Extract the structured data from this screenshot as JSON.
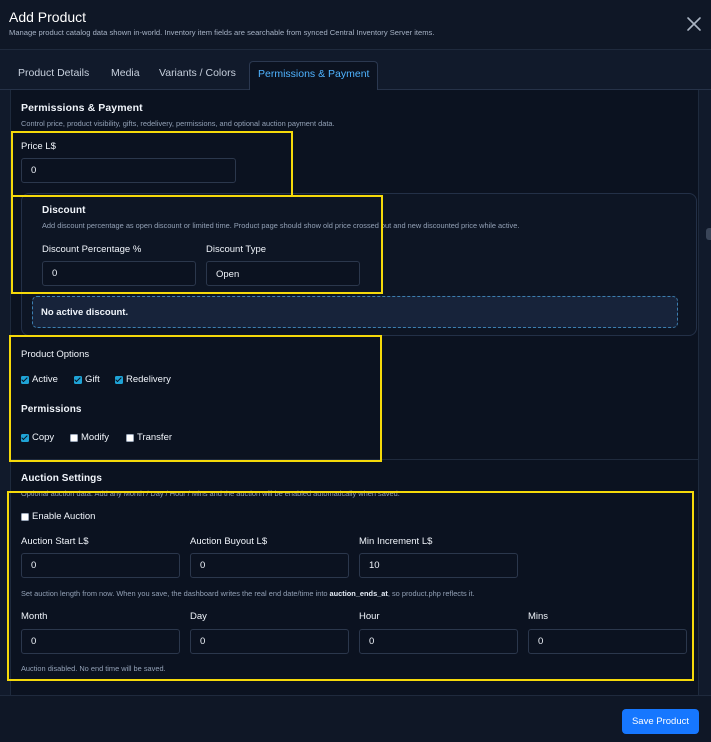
{
  "header": {
    "title": "Add Product",
    "subtitle": "Manage product catalog data shown in-world. Inventory item fields are searchable from synced Central Inventory Server items."
  },
  "tabs": [
    {
      "label": "Product Details",
      "active": false
    },
    {
      "label": "Media",
      "active": false
    },
    {
      "label": "Variants / Colors",
      "active": false
    },
    {
      "label": "Permissions & Payment",
      "active": true
    }
  ],
  "permissions_payment": {
    "title": "Permissions & Payment",
    "help": "Control price, product visibility, gifts, redelivery, permissions, and optional auction payment data.",
    "price_label": "Price L$",
    "price_value": "0"
  },
  "discount": {
    "title": "Discount",
    "help": "Add discount percentage as open discount or limited time. Product page should show old price crossed out and new discounted price while active.",
    "percentage_label": "Discount Percentage %",
    "percentage_value": "0",
    "type_label": "Discount Type",
    "type_value": "Open",
    "notice": "No active discount."
  },
  "product_options": {
    "title": "Product Options",
    "options": [
      {
        "label": "Active",
        "checked": true
      },
      {
        "label": "Gift",
        "checked": true
      },
      {
        "label": "Redelivery",
        "checked": true
      }
    ]
  },
  "permissions": {
    "title": "Permissions",
    "options": [
      {
        "label": "Copy",
        "checked": true
      },
      {
        "label": "Modify",
        "checked": false
      },
      {
        "label": "Transfer",
        "checked": false
      }
    ]
  },
  "auction": {
    "title": "Auction Settings",
    "help": "Optional auction data. Add any Month / Day / Hour / Mins and the auction will be enabled automatically when saved.",
    "enable_label": "Enable Auction",
    "enable_checked": false,
    "start_label": "Auction Start L$",
    "start_value": "0",
    "buyout_label": "Auction Buyout L$",
    "buyout_value": "0",
    "increment_label": "Min Increment L$",
    "increment_value": "10",
    "length_help_prefix": "Set auction length from now. When you save, the dashboard writes the real end date/time into ",
    "length_help_field": "auction_ends_at",
    "length_help_suffix": ", so product.php reflects it.",
    "month_label": "Month",
    "month_value": "0",
    "day_label": "Day",
    "day_value": "0",
    "hour_label": "Hour",
    "hour_value": "0",
    "mins_label": "Mins",
    "mins_value": "0",
    "status": "Auction disabled. No end time will be saved."
  },
  "footer": {
    "save_label": "Save Product"
  },
  "colors": {
    "accent": "#1677ff",
    "active_tab": "#4fb3ff",
    "highlight": "#f5d90a",
    "checkbox": "#1fa3d6"
  }
}
